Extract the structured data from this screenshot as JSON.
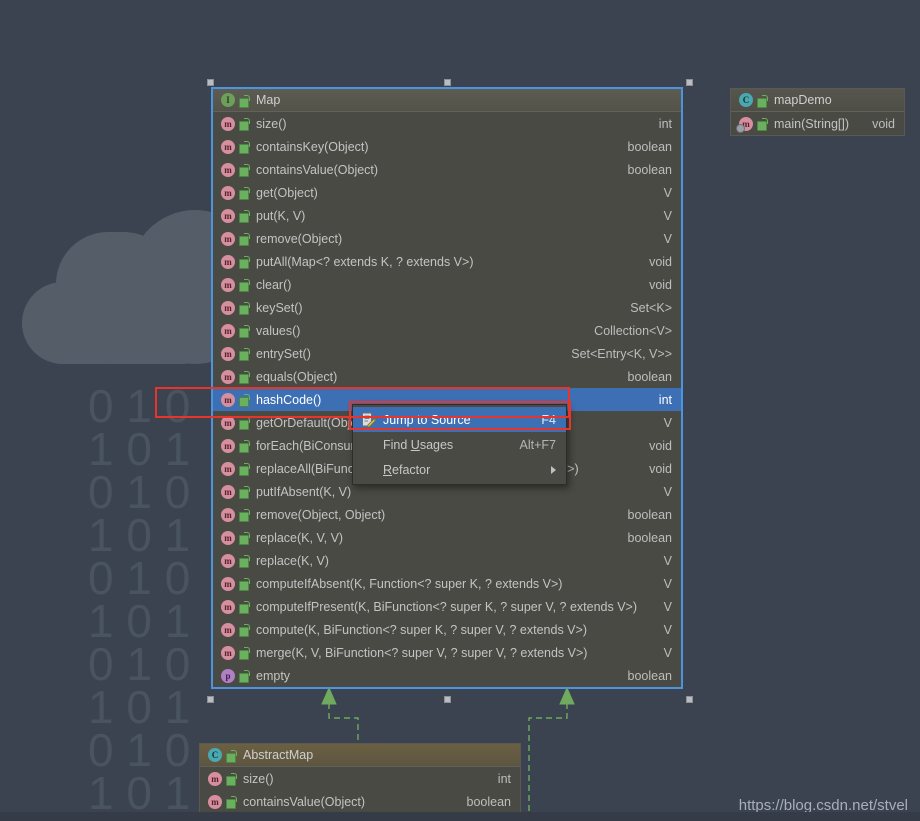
{
  "watermark": "https://blog.csdn.net/stvel",
  "background": {
    "binary_rows": [
      "0 1 0",
      "1 0 1",
      "0 1 0",
      "1 0 1",
      "0 1 0",
      "1 0 1",
      "0 1 0",
      "1 0 1",
      "0 1 0",
      "1 0 1"
    ]
  },
  "colors": {
    "canvas_bg": "#3b4350",
    "node_bg": "#4a4a44",
    "node_header": "#5c5c52",
    "node_header_olive": "#6b6043",
    "selection_blue": "#3d6fb5",
    "selected_border": "#4d94e0",
    "annotation_red": "#e8352b",
    "relation_green": "#6faa5e",
    "icon_interface_green": "#6ca05a",
    "icon_class_teal": "#4aa8b0",
    "icon_method_pink": "#d68f9e",
    "icon_property_purple": "#b07fc4"
  },
  "map_node": {
    "title": "Map",
    "title_icon": "interface-icon",
    "members": [
      {
        "icon": "method-icon",
        "name": "size()",
        "type": "int"
      },
      {
        "icon": "method-icon",
        "name": "containsKey(Object)",
        "type": "boolean"
      },
      {
        "icon": "method-icon",
        "name": "containsValue(Object)",
        "type": "boolean"
      },
      {
        "icon": "method-icon",
        "name": "get(Object)",
        "type": "V"
      },
      {
        "icon": "method-icon",
        "name": "put(K, V)",
        "type": "V"
      },
      {
        "icon": "method-icon",
        "name": "remove(Object)",
        "type": "V"
      },
      {
        "icon": "method-icon",
        "name": "putAll(Map<? extends K, ? extends V>)",
        "type": "void"
      },
      {
        "icon": "method-icon",
        "name": "clear()",
        "type": "void"
      },
      {
        "icon": "method-icon",
        "name": "keySet()",
        "type": "Set<K>"
      },
      {
        "icon": "method-icon",
        "name": "values()",
        "type": "Collection<V>"
      },
      {
        "icon": "method-icon",
        "name": "entrySet()",
        "type": "Set<Entry<K, V>>"
      },
      {
        "icon": "method-icon",
        "name": "equals(Object)",
        "type": "boolean"
      },
      {
        "icon": "method-icon",
        "name": "hashCode()",
        "type": "int",
        "selected": true
      },
      {
        "icon": "method-icon",
        "name": "getOrDefault(Object, V)",
        "type": "V"
      },
      {
        "icon": "method-icon",
        "name": "forEach(BiConsumer<? super K, ? super V>)",
        "type": "void"
      },
      {
        "icon": "method-icon",
        "name": "replaceAll(BiFunction<? super K, ? super V, ? extends V>)",
        "type": "void"
      },
      {
        "icon": "method-icon",
        "name": "putIfAbsent(K, V)",
        "type": "V"
      },
      {
        "icon": "method-icon",
        "name": "remove(Object, Object)",
        "type": "boolean"
      },
      {
        "icon": "method-icon",
        "name": "replace(K, V, V)",
        "type": "boolean"
      },
      {
        "icon": "method-icon",
        "name": "replace(K, V)",
        "type": "V"
      },
      {
        "icon": "method-icon",
        "name": "computeIfAbsent(K, Function<? super K, ? extends V>)",
        "type": "V"
      },
      {
        "icon": "method-icon",
        "name": "computeIfPresent(K, BiFunction<? super K, ? super V, ? extends V>)",
        "type": "V"
      },
      {
        "icon": "method-icon",
        "name": "compute(K, BiFunction<? super K, ? super V, ? extends V>)",
        "type": "V"
      },
      {
        "icon": "method-icon",
        "name": "merge(K, V, BiFunction<? super V, ? super V, ? extends V>)",
        "type": "V"
      },
      {
        "icon": "property-icon",
        "name": "empty",
        "type": "boolean"
      }
    ]
  },
  "mapdemo_node": {
    "title": "mapDemo",
    "title_icon": "class-icon",
    "members": [
      {
        "icon": "static-method-icon",
        "name": "main(String[])",
        "type": "void"
      }
    ]
  },
  "abstractmap_node": {
    "title": "AbstractMap",
    "title_icon": "class-icon",
    "members": [
      {
        "icon": "method-icon",
        "name": "size()",
        "type": "int"
      },
      {
        "icon": "method-icon",
        "name": "containsValue(Object)",
        "type": "boolean"
      }
    ]
  },
  "context_menu": {
    "items": [
      {
        "label": "Jump to Source",
        "accel": "F4",
        "icon": "jump-to-source-icon",
        "highlight": true,
        "submenu": false
      },
      {
        "label": "Find Usages",
        "accel": "Alt+F7",
        "icon": "",
        "highlight": false,
        "submenu": false,
        "mnemonic_index": 5
      },
      {
        "label": "Refactor",
        "accel": "",
        "icon": "",
        "highlight": false,
        "submenu": true,
        "mnemonic_index": 0
      }
    ]
  }
}
